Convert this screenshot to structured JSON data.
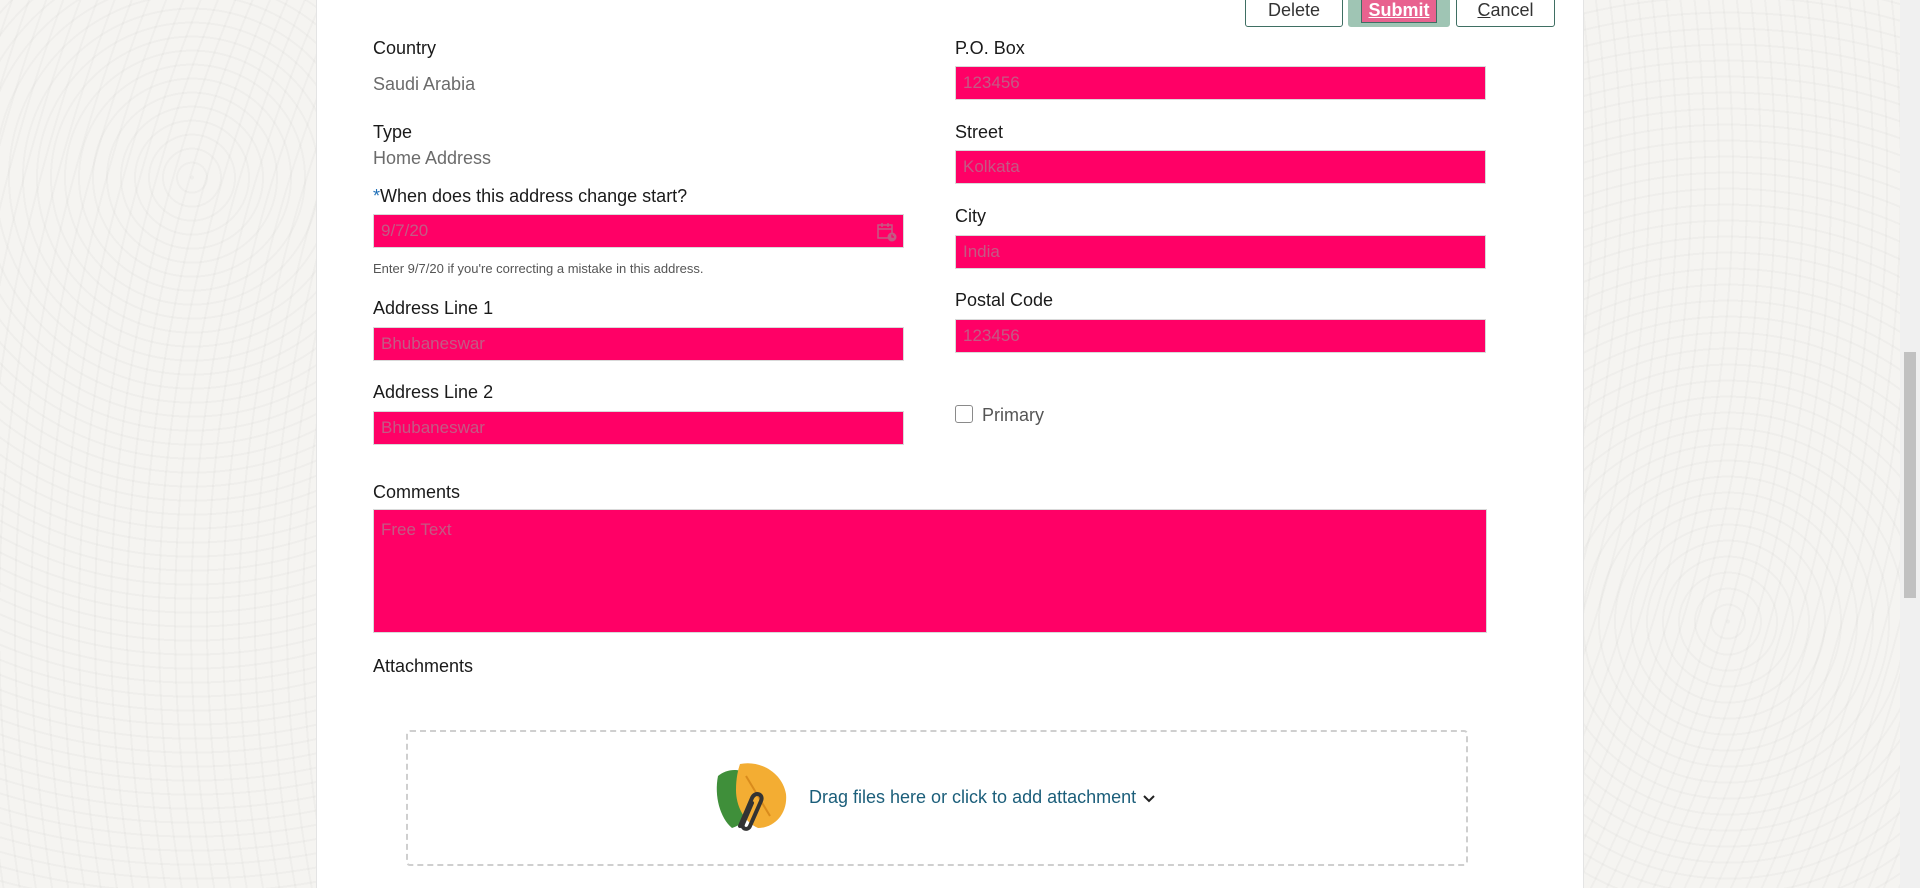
{
  "toolbar": {
    "delete_label": "Delete",
    "submit_label": "Submit",
    "cancel_prefix": "C",
    "cancel_rest": "ancel"
  },
  "form": {
    "country_label": "Country",
    "country_value": "Saudi Arabia",
    "type_label": "Type",
    "type_value": "Home Address",
    "start_required_mark": "*",
    "start_label": "When does this address change start?",
    "start_placeholder": "9/7/20",
    "start_hint": "Enter 9/7/20 if you're correcting a mistake in this address.",
    "address1_label": "Address Line 1",
    "address1_placeholder": "Bhubaneswar",
    "address2_label": "Address Line 2",
    "address2_placeholder": "Bhubaneswar",
    "pobox_label": "P.O. Box",
    "pobox_placeholder": "123456",
    "street_label": "Street",
    "street_placeholder": "Kolkata",
    "city_label": "City",
    "city_placeholder": "India",
    "postal_label": "Postal Code",
    "postal_placeholder": "123456",
    "primary_label": "Primary",
    "comments_label": "Comments",
    "comments_placeholder": "Free Text",
    "attachments_label": "Attachments",
    "drop_text": "Drag files here or click to add attachment"
  },
  "colors": {
    "field_bg": "#ff0066",
    "accent": "#3f6f63",
    "link": "#1b5e7a"
  },
  "icons": {
    "calendar": "calendar-icon",
    "chevron": "chevron-down-icon",
    "attachment": "leaf-paperclip-icon"
  }
}
